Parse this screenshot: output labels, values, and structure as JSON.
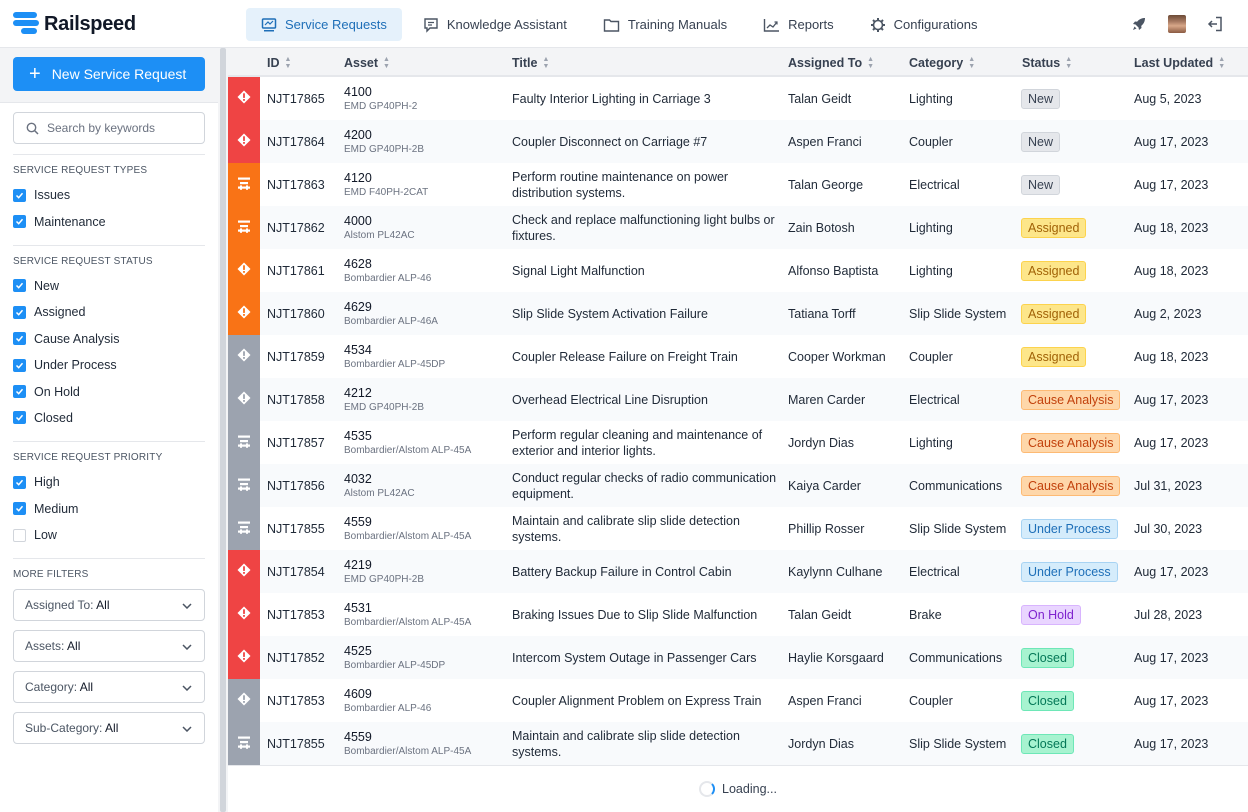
{
  "app": {
    "name": "Railspeed",
    "brand_color": "#1d8ff5"
  },
  "nav": {
    "items": [
      {
        "label": "Service Requests",
        "icon": "monitor-icon",
        "active": true
      },
      {
        "label": "Knowledge Assistant",
        "icon": "chat-icon",
        "active": false
      },
      {
        "label": "Training Manuals",
        "icon": "folder-icon",
        "active": false
      },
      {
        "label": "Reports",
        "icon": "chart-icon",
        "active": false
      },
      {
        "label": "Configurations",
        "icon": "gear-icon",
        "active": false
      }
    ],
    "right_icons": [
      "rocket-icon",
      "user-avatar",
      "logout-icon"
    ]
  },
  "sidebar": {
    "new_button": "New Service Request",
    "search_placeholder": "Search by keywords",
    "types": {
      "title": "SERVICE REQUEST TYPES",
      "items": [
        {
          "label": "Issues",
          "checked": true
        },
        {
          "label": "Maintenance",
          "checked": true
        }
      ]
    },
    "status": {
      "title": "SERVICE REQUEST STATUS",
      "items": [
        {
          "label": "New",
          "checked": true
        },
        {
          "label": "Assigned",
          "checked": true
        },
        {
          "label": "Cause Analysis",
          "checked": true
        },
        {
          "label": "Under Process",
          "checked": true
        },
        {
          "label": "On Hold",
          "checked": true
        },
        {
          "label": "Closed",
          "checked": true
        }
      ]
    },
    "priority": {
      "title": "SERVICE REQUEST PRIORITY",
      "items": [
        {
          "label": "High",
          "checked": true
        },
        {
          "label": "Medium",
          "checked": true
        },
        {
          "label": "Low",
          "checked": false
        }
      ]
    },
    "more_filters": {
      "title": "MORE FILTERS",
      "dropdowns": [
        {
          "label": "Assigned To:",
          "value": "All"
        },
        {
          "label": "Assets:",
          "value": "All"
        },
        {
          "label": "Category:",
          "value": "All"
        },
        {
          "label": "Sub-Category:",
          "value": "All"
        }
      ]
    }
  },
  "table": {
    "columns": [
      "ID",
      "Asset",
      "Title",
      "Assigned To",
      "Category",
      "Status",
      "Last Updated"
    ],
    "priority_colors": {
      "high": "#ef4444",
      "medium": "#f97316",
      "low": "#9ca3af"
    },
    "rows": [
      {
        "priority": "high",
        "type": "issue",
        "id": "NJT17865",
        "asset": "4100",
        "model": "EMD GP40PH-2",
        "title": "Faulty Interior Lighting in Carriage 3",
        "assigned": "Talan Geidt",
        "category": "Lighting",
        "status": "New",
        "updated": "Aug 5, 2023"
      },
      {
        "priority": "high",
        "type": "issue",
        "id": "NJT17864",
        "asset": "4200",
        "model": "EMD GP40PH-2B",
        "title": "Coupler Disconnect on Carriage #7",
        "assigned": "Aspen Franci",
        "category": "Coupler",
        "status": "New",
        "updated": "Aug 17, 2023"
      },
      {
        "priority": "medium",
        "type": "maintenance",
        "id": "NJT17863",
        "asset": "4120",
        "model": "EMD F40PH-2CAT",
        "title": "Perform routine maintenance on power distribution systems.",
        "assigned": "Talan George",
        "category": "Electrical",
        "status": "New",
        "updated": "Aug 17, 2023"
      },
      {
        "priority": "medium",
        "type": "maintenance",
        "id": "NJT17862",
        "asset": "4000",
        "model": "Alstom PL42AC",
        "title": "Check and replace malfunctioning light bulbs or fixtures.",
        "assigned": "Zain Botosh",
        "category": "Lighting",
        "status": "Assigned",
        "updated": "Aug 18, 2023"
      },
      {
        "priority": "medium",
        "type": "issue",
        "id": "NJT17861",
        "asset": "4628",
        "model": "Bombardier ALP-46",
        "title": "Signal Light Malfunction",
        "assigned": "Alfonso Baptista",
        "category": "Lighting",
        "status": "Assigned",
        "updated": "Aug 18, 2023"
      },
      {
        "priority": "medium",
        "type": "issue",
        "id": "NJT17860",
        "asset": "4629",
        "model": "Bombardier ALP-46A",
        "title": "Slip Slide System Activation Failure",
        "assigned": "Tatiana Torff",
        "category": "Slip Slide System",
        "status": "Assigned",
        "updated": "Aug 2, 2023"
      },
      {
        "priority": "low",
        "type": "issue",
        "id": "NJT17859",
        "asset": "4534",
        "model": "Bombardier ALP-45DP",
        "title": "Coupler Release Failure on Freight Train",
        "assigned": "Cooper Workman",
        "category": "Coupler",
        "status": "Assigned",
        "updated": "Aug 18, 2023"
      },
      {
        "priority": "low",
        "type": "issue",
        "id": "NJT17858",
        "asset": "4212",
        "model": "EMD GP40PH-2B",
        "title": "Overhead Electrical Line Disruption",
        "assigned": "Maren Carder",
        "category": "Electrical",
        "status": "Cause Analysis",
        "updated": "Aug 17, 2023"
      },
      {
        "priority": "low",
        "type": "maintenance",
        "id": "NJT17857",
        "asset": "4535",
        "model": "Bombardier/Alstom ALP-45A",
        "title": "Perform regular cleaning and maintenance of exterior and interior lights.",
        "assigned": "Jordyn Dias",
        "category": "Lighting",
        "status": "Cause Analysis",
        "updated": "Aug 17, 2023"
      },
      {
        "priority": "low",
        "type": "maintenance",
        "id": "NJT17856",
        "asset": "4032",
        "model": "Alstom PL42AC",
        "title": "Conduct regular checks of radio communication equipment.",
        "assigned": "Kaiya Carder",
        "category": "Communications",
        "status": "Cause Analysis",
        "updated": "Jul 31, 2023"
      },
      {
        "priority": "low",
        "type": "maintenance",
        "id": "NJT17855",
        "asset": "4559",
        "model": "Bombardier/Alstom ALP-45A",
        "title": "Maintain and calibrate slip slide detection systems.",
        "assigned": "Phillip Rosser",
        "category": "Slip Slide System",
        "status": "Under Process",
        "updated": "Jul 30, 2023"
      },
      {
        "priority": "high",
        "type": "issue",
        "id": "NJT17854",
        "asset": "4219",
        "model": "EMD GP40PH-2B",
        "title": "Battery Backup Failure in Control Cabin",
        "assigned": "Kaylynn Culhane",
        "category": "Electrical",
        "status": "Under Process",
        "updated": "Aug 17, 2023"
      },
      {
        "priority": "high",
        "type": "issue",
        "id": "NJT17853",
        "asset": "4531",
        "model": "Bombardier/Alstom ALP-45A",
        "title": "Braking Issues Due to Slip Slide Malfunction",
        "assigned": "Talan Geidt",
        "category": "Brake",
        "status": "On Hold",
        "updated": "Jul 28, 2023"
      },
      {
        "priority": "high",
        "type": "issue",
        "id": "NJT17852",
        "asset": "4525",
        "model": "Bombardier ALP-45DP",
        "title": "Intercom System Outage in Passenger Cars",
        "assigned": "Haylie Korsgaard",
        "category": "Communications",
        "status": "Closed",
        "updated": "Aug 17, 2023"
      },
      {
        "priority": "low",
        "type": "issue",
        "id": "NJT17853",
        "asset": "4609",
        "model": "Bombardier ALP-46",
        "title": "Coupler Alignment Problem on Express Train",
        "assigned": "Aspen Franci",
        "category": "Coupler",
        "status": "Closed",
        "updated": "Aug 17, 2023"
      },
      {
        "priority": "low",
        "type": "maintenance",
        "id": "NJT17855",
        "asset": "4559",
        "model": "Bombardier/Alstom ALP-45A",
        "title": "Maintain and calibrate slip slide detection systems.",
        "assigned": "Jordyn Dias",
        "category": "Slip Slide System",
        "status": "Closed",
        "updated": "Aug 17, 2023"
      }
    ],
    "loading_text": "Loading..."
  }
}
